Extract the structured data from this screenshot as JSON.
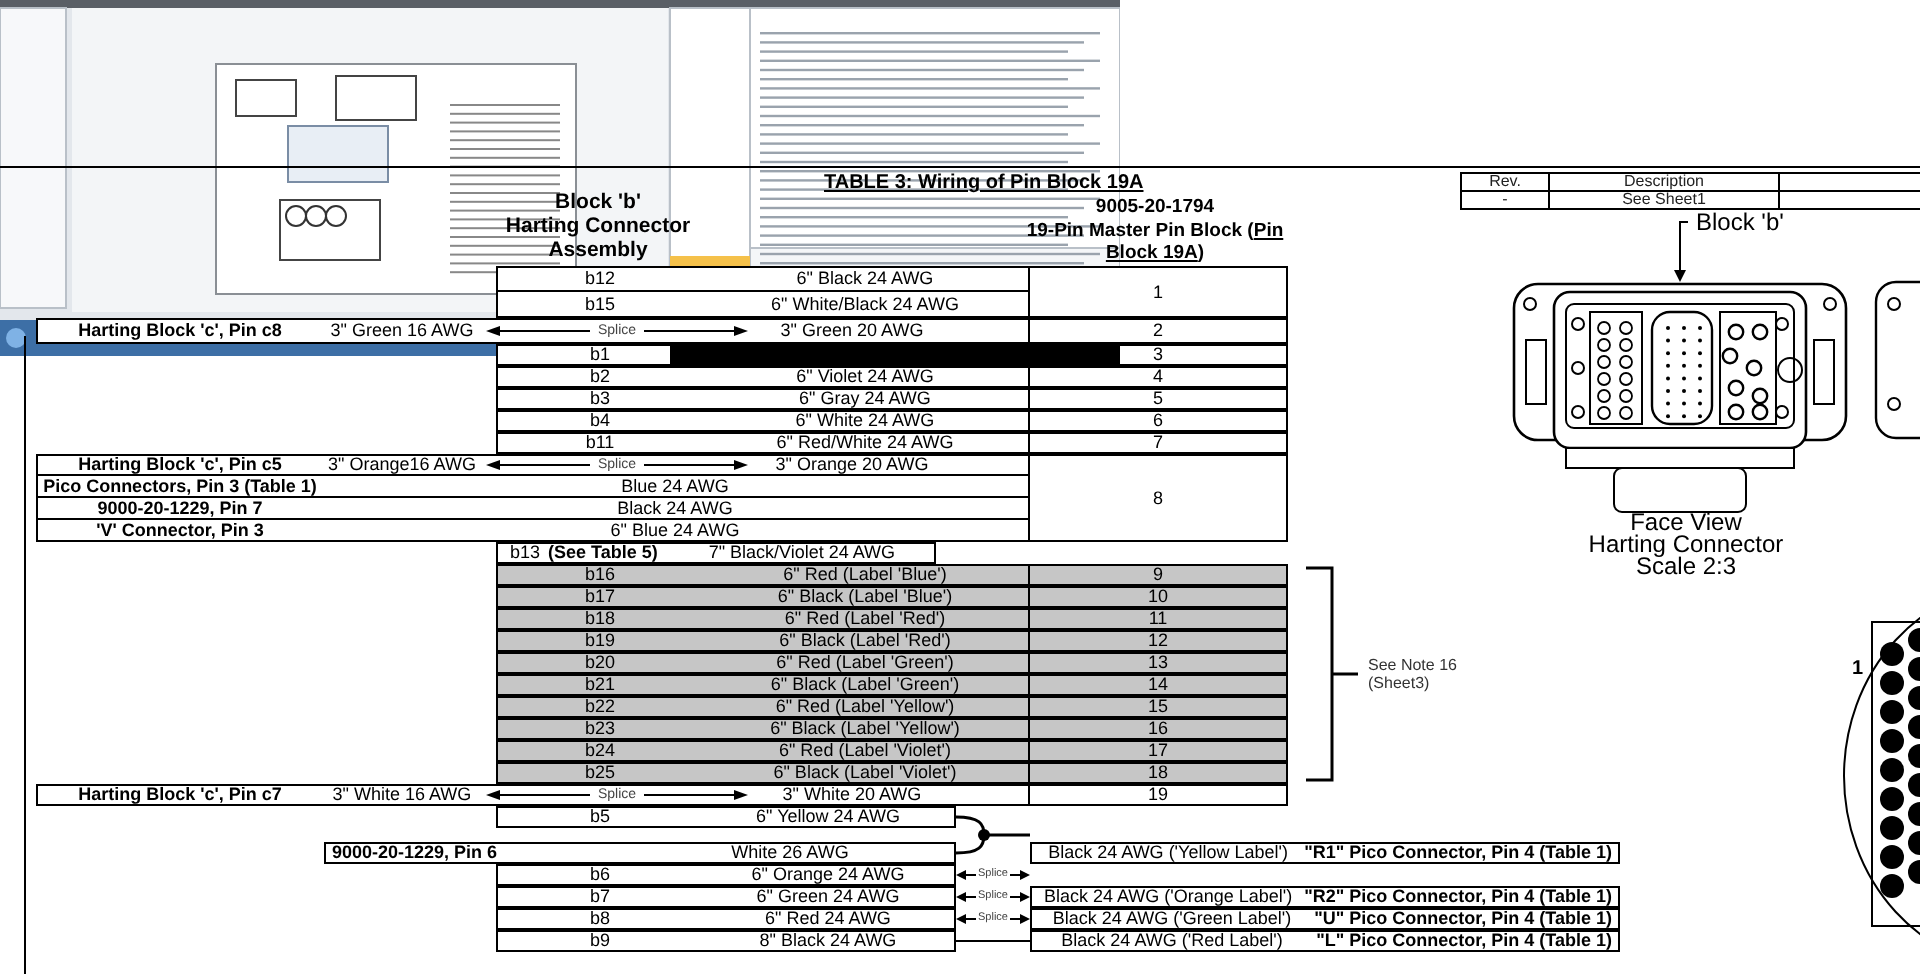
{
  "title": "TABLE 3: Wiring of Pin Block 19A",
  "assembly_heading": [
    "Block 'b'",
    "Harting Connector",
    "Assembly"
  ],
  "part_number": "9005-20-1794",
  "pin_block": {
    "before": "19-Pin Master Pin Block (",
    "underlined": "Pin Block 19A",
    "after": ")"
  },
  "sections": [
    {
      "kind": "table",
      "groups": [
        {
          "number": "1",
          "rows": [
            {
              "kind": "wire",
              "pin": "b12",
              "wire": "6\" Black 24 AWG"
            },
            {
              "kind": "wire",
              "pin": "b15",
              "wire": "6\" White/Black 24 AWG"
            }
          ]
        },
        {
          "number": "2",
          "rows": [
            {
              "kind": "splice",
              "label": "Harting Block 'c', Pin c8",
              "wire_in": "3\" Green 16 AWG",
              "splice": "Splice",
              "wire_out": "3\" Green 20 AWG"
            }
          ]
        },
        {
          "number": "3",
          "rows": [
            {
              "kind": "wire",
              "pin": "b1"
            }
          ]
        },
        {
          "number": "4",
          "rows": [
            {
              "kind": "wire",
              "pin": "b2",
              "wire": "6\" Violet 24 AWG"
            }
          ]
        },
        {
          "number": "5",
          "rows": [
            {
              "kind": "wire",
              "pin": "b3",
              "wire": "6\" Gray 24 AWG"
            }
          ]
        },
        {
          "number": "6",
          "rows": [
            {
              "kind": "wire",
              "pin": "b4",
              "wire": "6\" White 24 AWG"
            }
          ]
        },
        {
          "number": "7",
          "rows": [
            {
              "kind": "wire",
              "pin": "b11",
              "wire": "6\" Red/White 24 AWG"
            }
          ]
        },
        {
          "number": "8",
          "rows": [
            {
              "kind": "splice",
              "label": "Harting Block 'c', Pin c5",
              "wire_in": "3\" Orange16 AWG",
              "splice": "Splice",
              "wire_out": "3\" Orange 20 AWG"
            },
            {
              "kind": "external",
              "label": "Pico Connectors, Pin 3 (Table 1)",
              "wire": "Blue 24 AWG"
            },
            {
              "kind": "external",
              "label": "9000-20-1229, Pin 7",
              "wire": "Black 24 AWG"
            },
            {
              "kind": "external",
              "label": "'V' Connector, Pin 3",
              "wire": "6\" Blue 24 AWG"
            }
          ]
        },
        {
          "rows": [
            {
              "kind": "wire",
              "pin": "b13",
              "note": "(See Table 5)",
              "wire": "7\" Black/Violet 24 AWG"
            }
          ]
        }
      ]
    },
    {
      "kind": "bracketed",
      "note": [
        "See Note 16",
        "(Sheet3)"
      ],
      "groups": [
        {
          "number": "9",
          "shaded": true,
          "rows": [
            {
              "kind": "wire",
              "pin": "b16",
              "wire": "6\" Red (Label 'Blue')"
            }
          ]
        },
        {
          "number": "10",
          "shaded": true,
          "rows": [
            {
              "kind": "wire",
              "pin": "b17",
              "wire": "6\" Black (Label 'Blue')"
            }
          ]
        },
        {
          "number": "11",
          "shaded": true,
          "rows": [
            {
              "kind": "wire",
              "pin": "b18",
              "wire": "6\" Red (Label 'Red')"
            }
          ]
        },
        {
          "number": "12",
          "shaded": true,
          "rows": [
            {
              "kind": "wire",
              "pin": "b19",
              "wire": "6\" Black (Label 'Red')"
            }
          ]
        },
        {
          "number": "13",
          "shaded": true,
          "rows": [
            {
              "kind": "wire",
              "pin": "b20",
              "wire": "6\" Red (Label 'Green')"
            }
          ]
        },
        {
          "number": "14",
          "shaded": true,
          "rows": [
            {
              "kind": "wire",
              "pin": "b21",
              "wire": "6\" Black (Label 'Green')"
            }
          ]
        },
        {
          "number": "15",
          "shaded": true,
          "rows": [
            {
              "kind": "wire",
              "pin": "b22",
              "wire": "6\" Red (Label 'Yellow')"
            }
          ]
        },
        {
          "number": "16",
          "shaded": true,
          "rows": [
            {
              "kind": "wire",
              "pin": "b23",
              "wire": "6\" Black (Label 'Yellow')"
            }
          ]
        },
        {
          "number": "17",
          "shaded": true,
          "rows": [
            {
              "kind": "wire",
              "pin": "b24",
              "wire": "6\" Red (Label 'Violet')"
            }
          ]
        },
        {
          "number": "18",
          "shaded": true,
          "rows": [
            {
              "kind": "wire",
              "pin": "b25",
              "wire": "6\" Black (Label 'Violet')"
            }
          ]
        }
      ]
    },
    {
      "kind": "table",
      "groups": [
        {
          "number": "19",
          "rows": [
            {
              "kind": "splice",
              "label": "Harting Block 'c', Pin c7",
              "wire_in": "3\" White 16 AWG",
              "splice": "Splice",
              "wire_out": "3\" White 20 AWG"
            }
          ]
        }
      ]
    },
    {
      "kind": "harness",
      "rows": [
        {
          "kind": "wire",
          "pin": "b5",
          "wire": "6\" Yellow 24 AWG",
          "joined": true
        },
        {
          "kind": "external",
          "label": "9000-20-1229, Pin 6",
          "wire": "White 26 AWG",
          "joined": true,
          "far_wire": "Black 24 AWG ('Yellow Label')",
          "connector": "\"R1\" Pico Connector, Pin 4 (Table 1)"
        },
        {
          "kind": "wire",
          "pin": "b6",
          "wire": "6\" Orange 24 AWG",
          "splice": "Splice"
        },
        {
          "kind": "wire",
          "pin": "b7",
          "wire": "6\" Green 24 AWG",
          "splice": "Splice",
          "far_wire": "Black 24 AWG ('Orange Label')",
          "connector": "\"R2\" Pico Connector, Pin 4 (Table 1)"
        },
        {
          "kind": "wire",
          "pin": "b8",
          "wire": "6\" Red 24 AWG",
          "splice": "Splice",
          "far_wire": "Black 24 AWG ('Green Label')",
          "connector": "\"U\" Pico Connector, Pin 4 (Table 1)"
        },
        {
          "kind": "wire",
          "pin": "b9",
          "wire": "8\" Black 24 AWG",
          "far_wire": "Black 24 AWG ('Red Label')",
          "connector": "\"L\" Pico Connector, Pin 4 (Table 1)"
        }
      ]
    }
  ],
  "revision_table": {
    "columns": [
      "Rev.",
      "Description"
    ],
    "rows": [
      [
        "-",
        "See Sheet1"
      ]
    ]
  },
  "connector_view": {
    "callout": "Block 'b'",
    "caption": [
      "Face View",
      "Harting Connector",
      "Scale 2:3"
    ]
  },
  "side_view": {
    "pin_label": "1"
  }
}
